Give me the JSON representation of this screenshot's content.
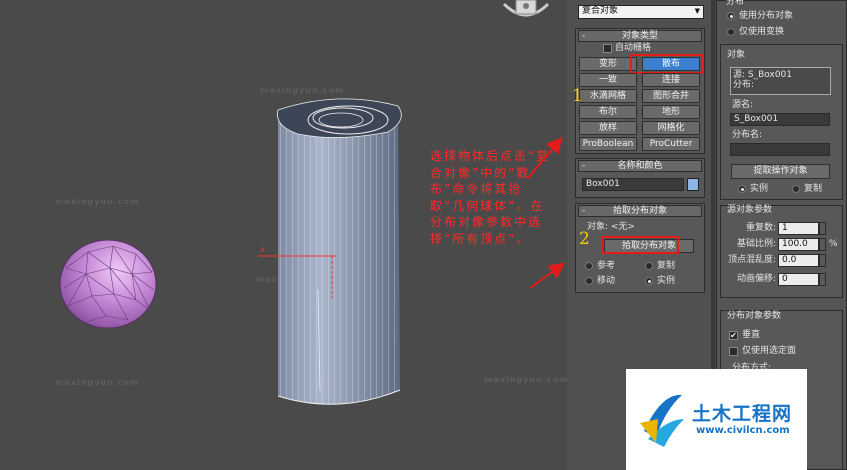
{
  "viewport": {
    "watermark": "moxingyun.com",
    "annotation_text": "选择物体后点击“复合对像”中的“散布”命令将其拾取“几何球体”。在分布对像参数中选择“所有顶点”。",
    "step1": "1",
    "step2": "2"
  },
  "dropdown": {
    "value": "复合对象",
    "arrow": "▼"
  },
  "object_type": {
    "header": "对象类型",
    "header_sign": "-",
    "autogrid_label": "自动栅格",
    "buttons": [
      "变形",
      "散布",
      "一致",
      "连接",
      "水滴网格",
      "图形合并",
      "布尔",
      "地形",
      "放样",
      "网格化",
      "ProBoolean",
      "ProCutter"
    ],
    "active_index": 1
  },
  "name_color": {
    "header": "名称和颜色",
    "header_sign": "-",
    "name_value": "Box001",
    "swatch_color": "#8fb4e6"
  },
  "pick_distribution": {
    "header": "拾取分布对象",
    "header_sign": "-",
    "object_label": "对象: <无>",
    "pick_button": "拾取分布对象",
    "options": [
      "参考",
      "复制",
      "移动",
      "实例"
    ],
    "selected_index": 3
  },
  "right_panel": {
    "distribute_label": "分布",
    "dist_options": [
      "使用分布对象",
      "仅使用变换"
    ],
    "dist_selected": 0,
    "objects_label": "对象",
    "objects_list": [
      "源: S_Box001",
      "分布:"
    ],
    "source_name_label": "源名:",
    "source_name_value": "S_Box001",
    "dist_name_label": "分布名:",
    "dist_name_value": "",
    "extract_button": "提取操作对象",
    "extract_options": [
      "实例",
      "复制"
    ],
    "extract_selected": 0,
    "source_params_label": "源对象参数",
    "params": [
      {
        "label": "重复数:",
        "value": "1"
      },
      {
        "label": "基础比例:",
        "value": "100.0"
      },
      {
        "label": "顶点混乱度:",
        "value": "0.0"
      },
      {
        "label": "动画偏移:",
        "value": "0"
      }
    ],
    "percent_sign": "%",
    "dist_params_label": "分布对象参数",
    "perpendicular_label": "垂直",
    "perpendicular_checked": true,
    "selected_faces_label": "仅使用选定面",
    "selected_faces_checked": false,
    "dist_method_label": "分布方式:",
    "check_mark": "✔"
  },
  "logo": {
    "title": "土木工程网",
    "url": "www.civilcn.com"
  },
  "colors": {
    "highlight_red": "#e21b1b",
    "active_blue": "#3a7fd0",
    "annotation_red": "#ff2a2a",
    "number_yellow": "#f5d000",
    "sphere_purple": "#c58ad6"
  }
}
